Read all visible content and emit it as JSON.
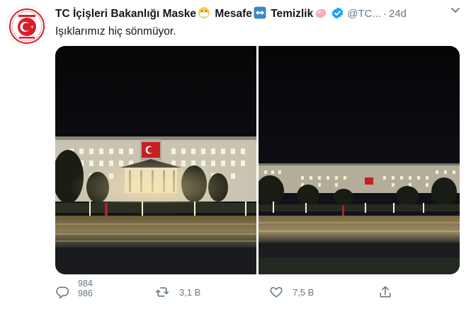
{
  "tweet": {
    "display_name_part1": "TC İçişleri Bakanlığı Maske",
    "display_name_part2": "Mesafe",
    "display_name_part3": "Temizlik",
    "handle": "@TC...",
    "separator": "·",
    "time": "24d",
    "text": "Işıklarımız hiç sönmüyor."
  },
  "icons": {
    "avatar": "ministry-emblem-icon",
    "emoji1": "face-with-mask-icon",
    "emoji2": "left-right-arrow-icon",
    "emoji3": "soap-icon",
    "verified": "verified-badge-icon",
    "caret": "chevron-down-icon",
    "reply": "reply-icon",
    "retweet": "retweet-icon",
    "like": "heart-icon",
    "share": "share-icon"
  },
  "media": {
    "photos": [
      "photo-left",
      "photo-right"
    ]
  },
  "actions": {
    "reply_count_old": "984",
    "reply_count_new": "986",
    "retweet_count": "3,1 B",
    "like_count": "7,5 B"
  },
  "colors": {
    "text_primary": "#14171a",
    "text_secondary": "#657786",
    "verified_blue": "#1da1f2",
    "emblem_red": "#d81e2c"
  }
}
